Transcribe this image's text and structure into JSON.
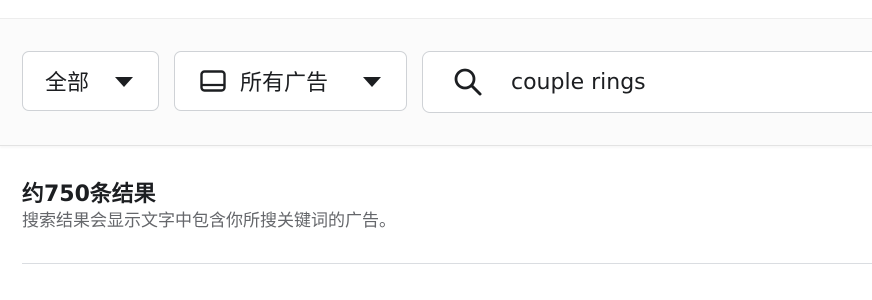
{
  "filters": {
    "category_label": "全部",
    "ad_type_label": "所有广告"
  },
  "search": {
    "value": "couple rings"
  },
  "results": {
    "count_text": "约750条结果",
    "description": "搜索结果会显示文字中包含你所搜关键词的广告。"
  },
  "icons": {
    "ad_type": "tablet-icon",
    "search": "search-icon",
    "dropdown": "caret-down-icon"
  },
  "colors": {
    "text_primary": "#1c1e21",
    "text_secondary": "#65676b",
    "border": "#cfd2d6"
  }
}
